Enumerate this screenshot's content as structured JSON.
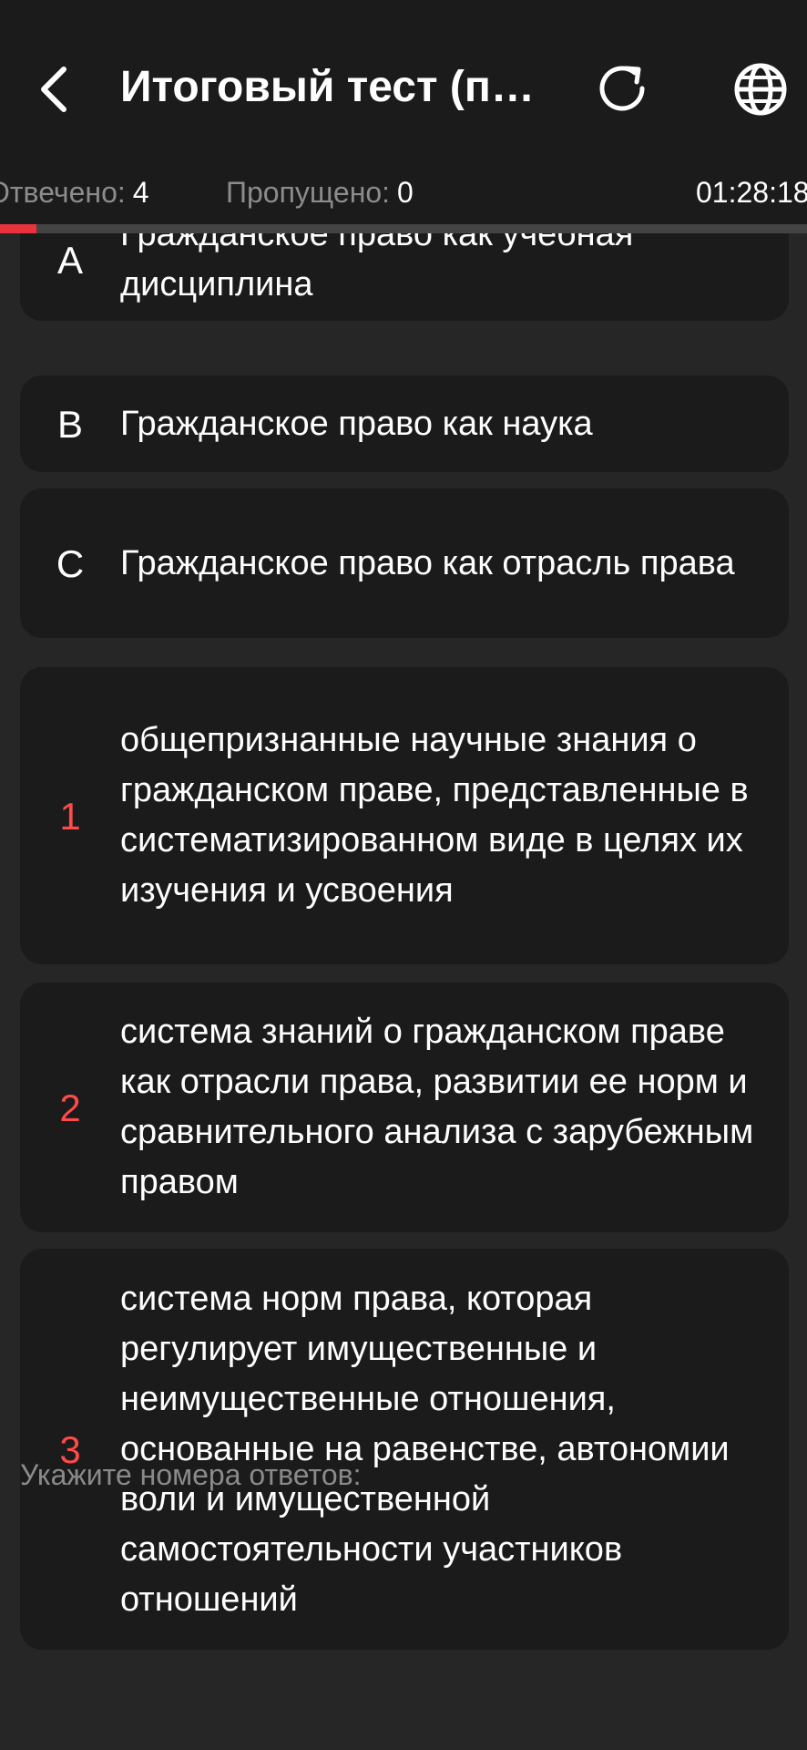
{
  "header": {
    "title": "Итоговый тест (пе..."
  },
  "status": {
    "answered_label": "Отвечено:",
    "answered_value": "4",
    "skipped_label": "Пропущено:",
    "skipped_value": "0",
    "timer": "01:28:18"
  },
  "progress": {
    "fraction": 0.045,
    "color": "#e8333b"
  },
  "options": [
    {
      "key": "A",
      "text": "Гражданское право как учебная дисциплина"
    },
    {
      "key": "B",
      "text": "Гражданское право как наука"
    },
    {
      "key": "C",
      "text": "Гражданское право как отрасль права"
    }
  ],
  "answers": [
    {
      "num": "1",
      "text": "общепризнанные научные знания о гражданском праве, представленные в систематизированном виде в целях их изучения и усвоения"
    },
    {
      "num": "2",
      "text": "система знаний о гражданском праве как отрасли права, развитии ее норм и сравнительного анализа с зарубежным правом"
    },
    {
      "num": "3",
      "text": "система норм права, которая регулирует имущественные и неимущественные отношения, основанные на равенстве, автономии воли и имущественной самостоятельности участников отношений"
    }
  ],
  "hint": "Укажите номера ответов:",
  "icons": {
    "back": "chevron-left-icon",
    "reload": "reload-icon",
    "language": "globe-icon"
  }
}
